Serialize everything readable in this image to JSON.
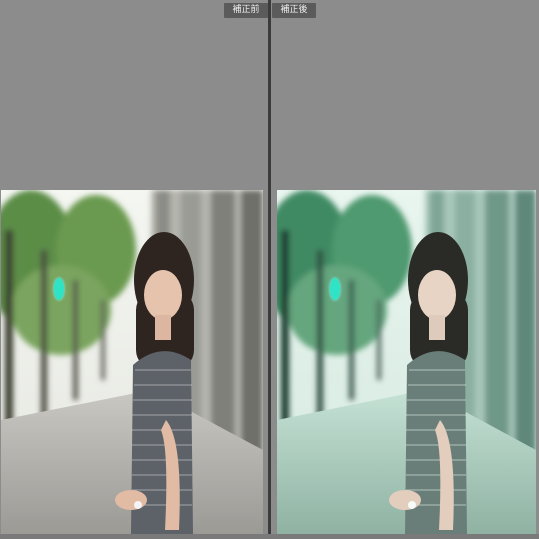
{
  "labels": {
    "before": "補正前",
    "after": "補正後"
  },
  "colors": {
    "background": "#8d8d8d",
    "divider": "#3b3b3b",
    "label_bg": "#5b5b5b",
    "marker": "#2ee3c6"
  },
  "images": {
    "before": {
      "alt": "portrait-before"
    },
    "after": {
      "alt": "portrait-after"
    }
  }
}
